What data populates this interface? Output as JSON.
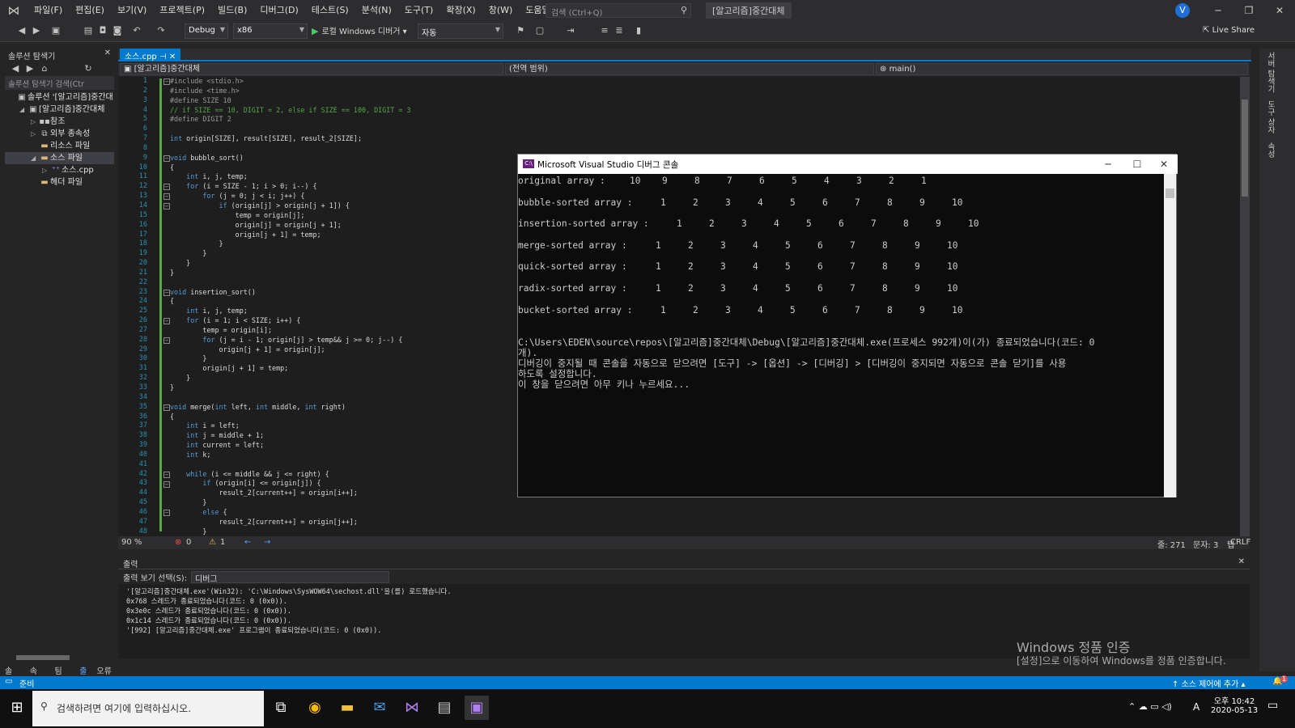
{
  "menu": [
    "파일(F)",
    "편집(E)",
    "보기(V)",
    "프로젝트(P)",
    "빌드(B)",
    "디버그(D)",
    "테스트(S)",
    "분석(N)",
    "도구(T)",
    "확장(X)",
    "창(W)",
    "도움말(H)"
  ],
  "search": {
    "placeholder": "검색 (Ctrl+Q)"
  },
  "window_title": "[알고리즘]중간대체",
  "user_initial": "V",
  "toolbar": {
    "config": "Debug",
    "platform": "x86",
    "run_label": "로컬 Windows 디버거",
    "run_mode": "자동",
    "liveshare": "Live Share"
  },
  "solution_explorer": {
    "title": "솔루션 탐색기",
    "search_placeholder": "솔루션 탐색기 검색(Ctr",
    "items": [
      {
        "label": "솔루션 '[알고리즘]중간대"
      },
      {
        "label": "[알고리즘]중간대체"
      },
      {
        "label": "참조"
      },
      {
        "label": "외부 종속성"
      },
      {
        "label": "리소스 파일"
      },
      {
        "label": "소스 파일"
      },
      {
        "label": "소스.cpp"
      },
      {
        "label": "헤더 파일"
      }
    ],
    "bottom_tabs": [
      "솔루...",
      "속성...",
      "팀 탐...",
      "출력",
      "오류 목록"
    ]
  },
  "editor": {
    "tab_label": "소스.cpp",
    "nav_project": "[알고리즘]중간대체",
    "nav_scope": "(전역 범위)",
    "nav_member": "main()",
    "lines": [
      "#include <stdio.h>",
      "#include <time.h>",
      "#define SIZE 10",
      "// if SIZE == 10, DIGIT = 2, else if SIZE == 100, DIGIT = 3",
      "#define DIGIT 2",
      "",
      "int origin[SIZE], result[SIZE], result_2[SIZE];",
      "",
      "void bubble_sort()",
      "{",
      "    int i, j, temp;",
      "    for (i = SIZE - 1; i > 0; i--) {",
      "        for (j = 0; j < i; j++) {",
      "            if (origin[j] > origin[j + 1]) {",
      "                temp = origin[j];",
      "                origin[j] = origin[j + 1];",
      "                origin[j + 1] = temp;",
      "            }",
      "        }",
      "    }",
      "}",
      "",
      "void insertion_sort()",
      "{",
      "    int i, j, temp;",
      "    for (i = 1; i < SIZE; i++) {",
      "        temp = origin[i];",
      "        for (j = i - 1; origin[j] > temp&& j >= 0; j--) {",
      "            origin[j + 1] = origin[j];",
      "        }",
      "        origin[j + 1] = temp;",
      "    }",
      "}",
      "",
      "void merge(int left, int middle, int right)",
      "{",
      "    int i = left;",
      "    int j = middle + 1;",
      "    int current = left;",
      "    int k;",
      "",
      "    while (i <= middle && j <= right) {",
      "        if (origin[i] <= origin[j]) {",
      "            result_2[current++] = origin[i++];",
      "        }",
      "        else {",
      "            result_2[current++] = origin[j++];",
      "        }"
    ],
    "zoom": "90 %",
    "errors": "0",
    "warnings": "1",
    "line_pos": "줄: 271",
    "char_pos": "문자: 3",
    "tab_mode": "탭",
    "eol": "CRLF"
  },
  "output": {
    "title": "출력",
    "source_label": "출력 보기 선택(S):",
    "source_value": "디버그",
    "lines": [
      "'[알고리즘]중간대체.exe'(Win32): 'C:\\Windows\\SysWOW64\\sechost.dll'을(를) 로드했습니다.",
      "0x768 스레드가 종료되었습니다(코드: 0 (0x0)).",
      "0x3e0c 스레드가 종료되었습니다(코드: 0 (0x0)).",
      "0x1c14 스레드가 종료되었습니다(코드: 0 (0x0)).",
      "'[992] [알고리즘]중간대체.exe' 프로그램이 종료되었습니다(코드: 0 (0x0))."
    ]
  },
  "watermark": {
    "title": "Windows 정품 인증",
    "subtitle": "[설정]으로 이동하여 Windows를 정품 인증합니다."
  },
  "statusbar": {
    "ready": "준비",
    "source_control": "소스 제어에 추가",
    "notif": "1"
  },
  "right_rail": [
    "서버 탐색기",
    "도구 상자",
    "속성"
  ],
  "taskbar": {
    "search_placeholder": "검색하려면 여기에 입력하십시오.",
    "time": "오후 10:42",
    "date": "2020-05-13",
    "ime": "A"
  },
  "console": {
    "title": "Microsoft Visual Studio 디버그 콘솔",
    "rows": [
      {
        "label": "original array :",
        "values": [
          "10",
          "9",
          "8",
          "7",
          "6",
          "5",
          "4",
          "3",
          "2",
          "1"
        ]
      },
      {
        "label": "bubble-sorted array :",
        "values": [
          "1",
          "2",
          "3",
          "4",
          "5",
          "6",
          "7",
          "8",
          "9",
          "10"
        ]
      },
      {
        "label": "insertion-sorted array :",
        "values": [
          "1",
          "2",
          "3",
          "4",
          "5",
          "6",
          "7",
          "8",
          "9",
          "10"
        ]
      },
      {
        "label": "merge-sorted array :",
        "values": [
          "1",
          "2",
          "3",
          "4",
          "5",
          "6",
          "7",
          "8",
          "9",
          "10"
        ]
      },
      {
        "label": "quick-sorted array :",
        "values": [
          "1",
          "2",
          "3",
          "4",
          "5",
          "6",
          "7",
          "8",
          "9",
          "10"
        ]
      },
      {
        "label": "radix-sorted array :",
        "values": [
          "1",
          "2",
          "3",
          "4",
          "5",
          "6",
          "7",
          "8",
          "9",
          "10"
        ]
      },
      {
        "label": "bucket-sorted array :",
        "values": [
          "1",
          "2",
          "3",
          "4",
          "5",
          "6",
          "7",
          "8",
          "9",
          "10"
        ]
      }
    ],
    "exit_line1": "C:\\Users\\EDEN\\source\\repos\\[알고리즘]중간대체\\Debug\\[알고리즘]중간대체.exe(프로세스 992개)이(가) 종료되었습니다(코드: 0",
    "exit_line2": "개).",
    "hint_line1": "디버깅이 중지될 때 콘솔을 자동으로 닫으려면 [도구] -> [옵션] -> [디버깅] > [디버깅이 중지되면 자동으로 콘솔 닫기]를 사용",
    "hint_line2": "하도록 설정합니다.",
    "press_key": "이 창을 닫으려면 아무 키나 누르세요..."
  }
}
